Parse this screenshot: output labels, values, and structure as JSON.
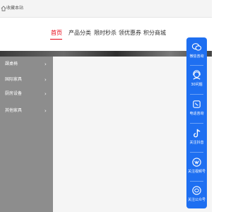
{
  "topbar": {
    "favorite_label": "收藏本站",
    "home_icon": "home-icon"
  },
  "nav": {
    "items": [
      {
        "label": "首页",
        "active": true
      },
      {
        "label": "产品分类",
        "active": false
      },
      {
        "label": "限时秒杀",
        "active": false
      },
      {
        "label": "领优惠券",
        "active": false
      },
      {
        "label": "积分商城",
        "active": false
      }
    ],
    "active_color": "#e60012"
  },
  "sidebar": {
    "categories": [
      {
        "label": "課桌椅",
        "chevron": "›"
      },
      {
        "label": "国际家具",
        "chevron": "›"
      },
      {
        "label": "厨房设备",
        "chevron": "›"
      },
      {
        "label": "其他家具",
        "chevron": "›"
      }
    ],
    "background": "#8d8d8d"
  },
  "float_panel": {
    "background": "#1e6ff1",
    "items": [
      {
        "label": "微信咨询",
        "icon": "wechat-icon"
      },
      {
        "label": "30问题",
        "icon": "support-agent-icon"
      },
      {
        "label": "电话咨询",
        "icon": "phone-icon"
      },
      {
        "label": "关注抖音",
        "icon": "tiktok-icon"
      },
      {
        "label": "关注视频号",
        "icon": "video-channel-icon"
      },
      {
        "label": "关注公众号",
        "icon": "wechat-official-icon"
      }
    ]
  }
}
